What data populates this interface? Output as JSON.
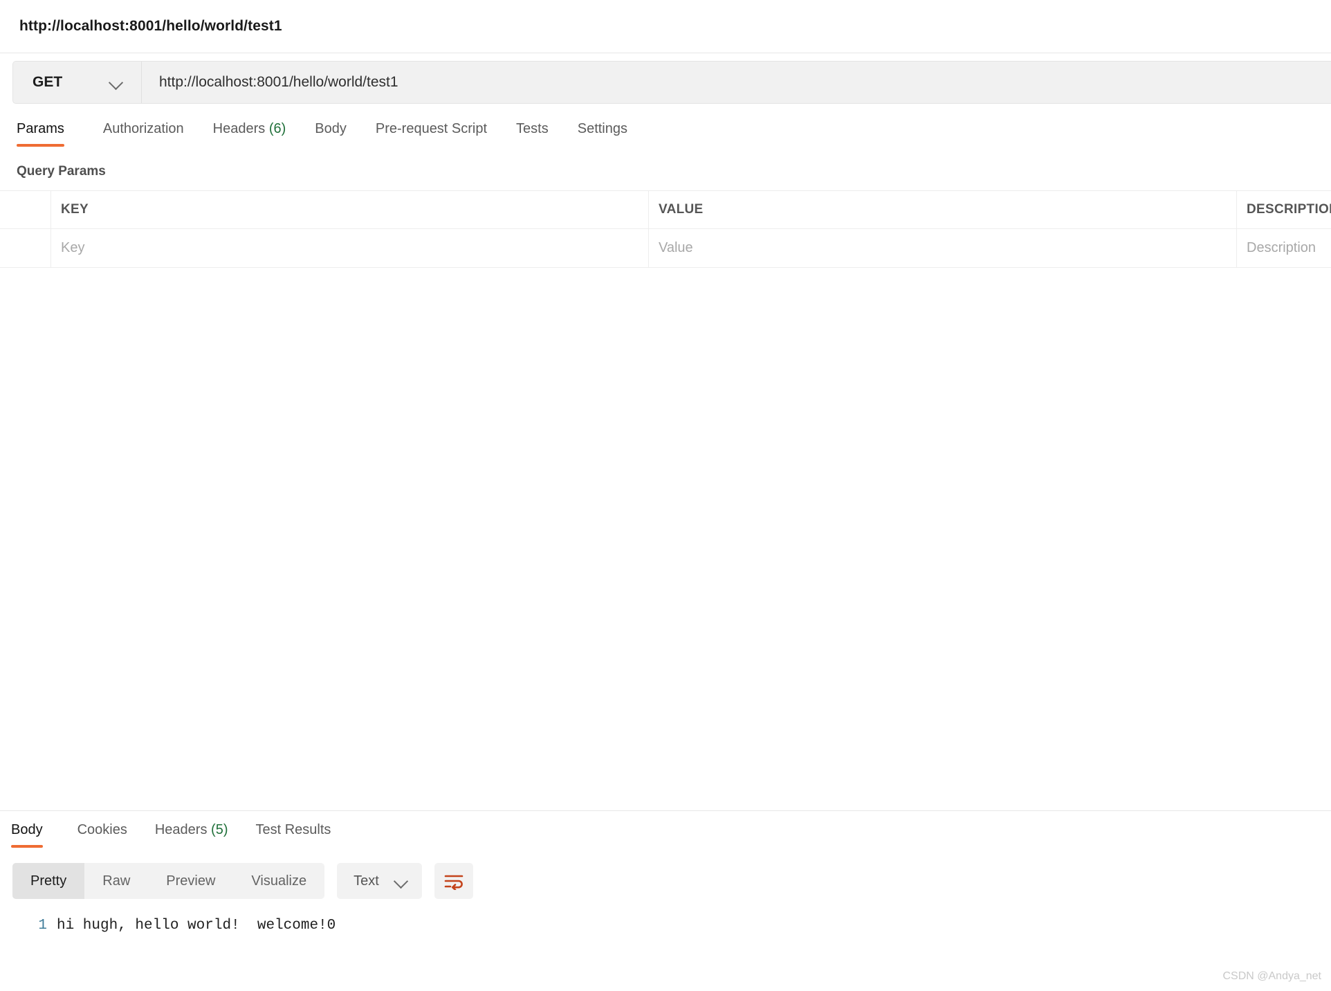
{
  "request": {
    "title": "http://localhost:8001/hello/world/test1",
    "method": "GET",
    "url": "http://localhost:8001/hello/world/test1",
    "tabs": [
      {
        "label": "Params",
        "count": "",
        "active": true
      },
      {
        "label": "Authorization",
        "count": "",
        "active": false
      },
      {
        "label": "Headers",
        "count": "(6)",
        "active": false
      },
      {
        "label": "Body",
        "count": "",
        "active": false
      },
      {
        "label": "Pre-request Script",
        "count": "",
        "active": false
      },
      {
        "label": "Tests",
        "count": "",
        "active": false
      },
      {
        "label": "Settings",
        "count": "",
        "active": false
      }
    ]
  },
  "query_params": {
    "section_title": "Query Params",
    "columns": {
      "key": "KEY",
      "value": "VALUE",
      "description": "DESCRIPTION"
    },
    "placeholder_row": {
      "key": "Key",
      "value": "Value",
      "description": "Description"
    }
  },
  "response": {
    "tabs": [
      {
        "label": "Body",
        "count": "",
        "active": true
      },
      {
        "label": "Cookies",
        "count": "",
        "active": false
      },
      {
        "label": "Headers",
        "count": "(5)",
        "active": false
      },
      {
        "label": "Test Results",
        "count": "",
        "active": false
      }
    ],
    "view_modes": [
      {
        "label": "Pretty",
        "active": true
      },
      {
        "label": "Raw",
        "active": false
      },
      {
        "label": "Preview",
        "active": false
      },
      {
        "label": "Visualize",
        "active": false
      }
    ],
    "format": "Text",
    "wrap_icon": "wrap-lines-icon",
    "line_number": "1",
    "body_text": "hi hugh, hello world!  welcome!0"
  },
  "watermark": "CSDN @Andya_net",
  "colors": {
    "accent": "#ef6c33",
    "count_green": "#20703a",
    "wrap_icon": "#c4441c",
    "line_number": "#3f7c99"
  }
}
